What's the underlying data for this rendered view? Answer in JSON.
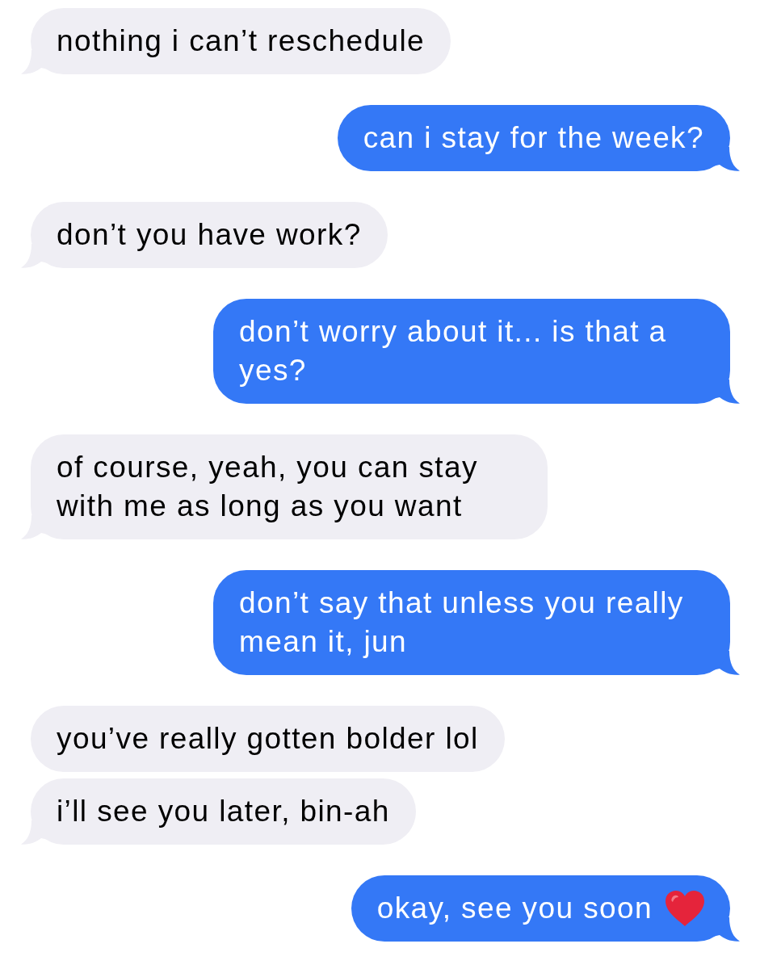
{
  "messages": [
    {
      "kind": "received",
      "text": "nothing i can’t reschedule",
      "tail": true,
      "end_icon": false
    },
    {
      "kind": "sent",
      "text": "can i stay for the week?",
      "tail": true,
      "end_icon": false
    },
    {
      "kind": "received",
      "text": "don’t you have work?",
      "tail": true,
      "end_icon": false
    },
    {
      "kind": "sent",
      "text": "don’t worry about it... is that a yes?",
      "tail": true,
      "end_icon": false
    },
    {
      "kind": "received",
      "text": "of course, yeah, you can stay with me as long as you want",
      "tail": true,
      "end_icon": false
    },
    {
      "kind": "sent",
      "text": "don’t say that unless you really mean it, jun",
      "tail": true,
      "end_icon": false
    },
    {
      "kind": "received",
      "text": "you’ve really gotten bolder lol",
      "tail": false,
      "end_icon": false
    },
    {
      "kind": "received",
      "text": "i’ll see you later, bin-ah",
      "tail": true,
      "end_icon": false
    },
    {
      "kind": "sent",
      "text": "okay, see you soon",
      "tail": true,
      "end_icon": true
    }
  ]
}
